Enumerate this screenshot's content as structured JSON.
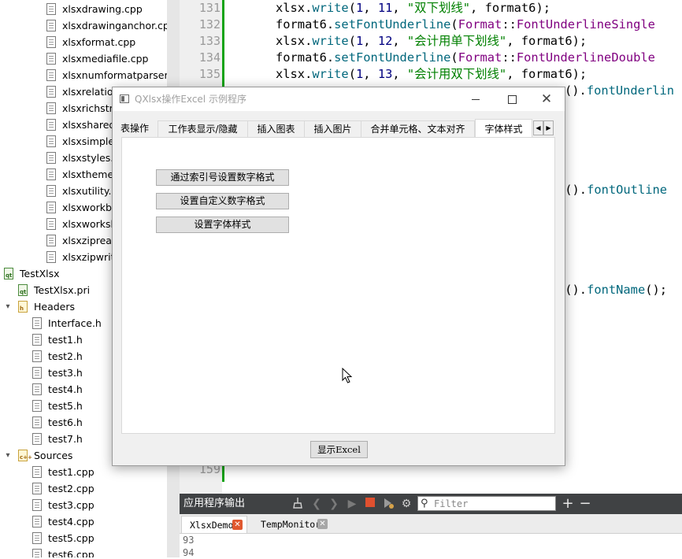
{
  "project_tree": {
    "items": [
      {
        "label": "xlsxdrawing.cpp",
        "icon": "file-icon",
        "indent": 3,
        "arrow": ""
      },
      {
        "label": "xlsxdrawinganchor.cpp",
        "icon": "file-icon",
        "indent": 3,
        "arrow": ""
      },
      {
        "label": "xlsxformat.cpp",
        "icon": "file-icon",
        "indent": 3,
        "arrow": ""
      },
      {
        "label": "xlsxmediafile.cpp",
        "icon": "file-icon",
        "indent": 3,
        "arrow": ""
      },
      {
        "label": "xlsxnumformatparser.c",
        "icon": "file-icon",
        "indent": 3,
        "arrow": ""
      },
      {
        "label": "xlsxrelation",
        "icon": "file-icon",
        "indent": 3,
        "arrow": ""
      },
      {
        "label": "xlsxrichstri",
        "icon": "file-icon",
        "indent": 3,
        "arrow": ""
      },
      {
        "label": "xlsxsharedst",
        "icon": "file-icon",
        "indent": 3,
        "arrow": ""
      },
      {
        "label": "xlsxsimplecc",
        "icon": "file-icon",
        "indent": 3,
        "arrow": ""
      },
      {
        "label": "xlsxstyles.cp",
        "icon": "file-icon",
        "indent": 3,
        "arrow": ""
      },
      {
        "label": "xlsxtheme.cp",
        "icon": "file-icon",
        "indent": 3,
        "arrow": ""
      },
      {
        "label": "xlsxutility.cp",
        "icon": "file-icon",
        "indent": 3,
        "arrow": ""
      },
      {
        "label": "xlsxworkbo",
        "icon": "file-icon",
        "indent": 3,
        "arrow": ""
      },
      {
        "label": "xlsxworksh",
        "icon": "file-icon",
        "indent": 3,
        "arrow": ""
      },
      {
        "label": "xlsxzipread",
        "icon": "file-icon",
        "indent": 3,
        "arrow": ""
      },
      {
        "label": "xlsxzipwrite",
        "icon": "file-icon",
        "indent": 3,
        "arrow": ""
      },
      {
        "label": "TestXlsx",
        "icon": "project-icon",
        "indent": 0,
        "arrow": ""
      },
      {
        "label": "TestXlsx.pri",
        "icon": "pri-file-icon",
        "indent": 1,
        "arrow": ""
      },
      {
        "label": "Headers",
        "icon": "headers-folder-icon",
        "indent": 1,
        "arrow": "▾"
      },
      {
        "label": "Interface.h",
        "icon": "file-icon",
        "indent": 2,
        "arrow": ""
      },
      {
        "label": "test1.h",
        "icon": "file-icon",
        "indent": 2,
        "arrow": ""
      },
      {
        "label": "test2.h",
        "icon": "file-icon",
        "indent": 2,
        "arrow": ""
      },
      {
        "label": "test3.h",
        "icon": "file-icon",
        "indent": 2,
        "arrow": ""
      },
      {
        "label": "test4.h",
        "icon": "file-icon",
        "indent": 2,
        "arrow": ""
      },
      {
        "label": "test5.h",
        "icon": "file-icon",
        "indent": 2,
        "arrow": ""
      },
      {
        "label": "test6.h",
        "icon": "file-icon",
        "indent": 2,
        "arrow": ""
      },
      {
        "label": "test7.h",
        "icon": "file-icon",
        "indent": 2,
        "arrow": ""
      },
      {
        "label": "Sources",
        "icon": "sources-folder-icon",
        "indent": 1,
        "arrow": "▾"
      },
      {
        "label": "test1.cpp",
        "icon": "file-icon",
        "indent": 2,
        "arrow": ""
      },
      {
        "label": "test2.cpp",
        "icon": "file-icon",
        "indent": 2,
        "arrow": ""
      },
      {
        "label": "test3.cpp",
        "icon": "file-icon",
        "indent": 2,
        "arrow": ""
      },
      {
        "label": "test4.cpp",
        "icon": "file-icon",
        "indent": 2,
        "arrow": ""
      },
      {
        "label": "test5.cpp",
        "icon": "file-icon",
        "indent": 2,
        "arrow": ""
      },
      {
        "label": "test6.cpp",
        "icon": "file-icon",
        "indent": 2,
        "arrow": ""
      }
    ]
  },
  "editor": {
    "line_numbers": {
      "l131": "131",
      "l132": "132",
      "l133": "133",
      "l134": "134",
      "l135": "135",
      "l159": "159"
    },
    "code": {
      "l131": [
        {
          "t": "xlsx",
          "c": "obj"
        },
        {
          "t": ".",
          "c": "obj"
        },
        {
          "t": "write",
          "c": "fn"
        },
        {
          "t": "(",
          "c": "obj"
        },
        {
          "t": "1",
          "c": "num"
        },
        {
          "t": ", ",
          "c": "obj"
        },
        {
          "t": "11",
          "c": "num"
        },
        {
          "t": ", ",
          "c": "obj"
        },
        {
          "t": "\"双下划线\"",
          "c": "str"
        },
        {
          "t": ", ",
          "c": "obj"
        },
        {
          "t": "format6",
          "c": "obj"
        },
        {
          "t": ");",
          "c": "obj"
        }
      ],
      "l132": [
        {
          "t": "format6",
          "c": "obj"
        },
        {
          "t": ".",
          "c": "obj"
        },
        {
          "t": "setFontUnderline",
          "c": "fn"
        },
        {
          "t": "(",
          "c": "obj"
        },
        {
          "t": "Format",
          "c": "cls"
        },
        {
          "t": "::",
          "c": "obj"
        },
        {
          "t": "FontUnderlineSingle",
          "c": "enum"
        }
      ],
      "l133": [
        {
          "t": "xlsx",
          "c": "obj"
        },
        {
          "t": ".",
          "c": "obj"
        },
        {
          "t": "write",
          "c": "fn"
        },
        {
          "t": "(",
          "c": "obj"
        },
        {
          "t": "1",
          "c": "num"
        },
        {
          "t": ", ",
          "c": "obj"
        },
        {
          "t": "12",
          "c": "num"
        },
        {
          "t": ", ",
          "c": "obj"
        },
        {
          "t": "\"会计用单下划线\"",
          "c": "str"
        },
        {
          "t": ", ",
          "c": "obj"
        },
        {
          "t": "format6",
          "c": "obj"
        },
        {
          "t": ");",
          "c": "obj"
        }
      ],
      "l134": [
        {
          "t": "format6",
          "c": "obj"
        },
        {
          "t": ".",
          "c": "obj"
        },
        {
          "t": "setFontUnderline",
          "c": "fn"
        },
        {
          "t": "(",
          "c": "obj"
        },
        {
          "t": "Format",
          "c": "cls"
        },
        {
          "t": "::",
          "c": "obj"
        },
        {
          "t": "FontUnderlineDouble",
          "c": "enum"
        }
      ],
      "l135": [
        {
          "t": "xlsx",
          "c": "obj"
        },
        {
          "t": ".",
          "c": "obj"
        },
        {
          "t": "write",
          "c": "fn"
        },
        {
          "t": "(",
          "c": "obj"
        },
        {
          "t": "1",
          "c": "num"
        },
        {
          "t": ", ",
          "c": "obj"
        },
        {
          "t": "13",
          "c": "num"
        },
        {
          "t": ", ",
          "c": "obj"
        },
        {
          "t": "\"会计用双下划线\"",
          "c": "str"
        },
        {
          "t": ", ",
          "c": "obj"
        },
        {
          "t": "format6",
          "c": "obj"
        },
        {
          "t": ");",
          "c": "obj"
        }
      ],
      "frag1": [
        {
          "t": "().",
          "c": "obj"
        },
        {
          "t": "fontUnderlin",
          "c": "fn"
        }
      ],
      "frag2": [
        {
          "t": ";",
          "c": "obj"
        }
      ],
      "frag3": [
        {
          "t": "t().",
          "c": "obj"
        },
        {
          "t": "fontOutline",
          "c": "fn"
        }
      ],
      "frag4": [
        {
          "t": ";",
          "c": "obj"
        }
      ],
      "frag5": [
        {
          "t": "t().",
          "c": "obj"
        },
        {
          "t": "fontName",
          "c": "fn"
        },
        {
          "t": "();",
          "c": "obj"
        }
      ]
    }
  },
  "output_panel": {
    "title": "应用程序输出",
    "filter_placeholder": "Filter",
    "tabs": [
      {
        "label": "XlsxDemo",
        "active": true
      },
      {
        "label": "TempMonitor",
        "active": false
      }
    ],
    "lines": [
      "93",
      "94"
    ]
  },
  "dialog": {
    "title": "QXlsx操作Excel 示例程序",
    "tabs": [
      {
        "label": "表操作",
        "selected": false
      },
      {
        "label": "工作表显示/隐藏",
        "selected": false
      },
      {
        "label": "插入图表",
        "selected": false
      },
      {
        "label": "插入图片",
        "selected": false
      },
      {
        "label": "合并单元格、文本对齐",
        "selected": false
      },
      {
        "label": "字体样式",
        "selected": true
      }
    ],
    "buttons": {
      "index_number_format": "通过索引号设置数字格式",
      "custom_number_format": "设置自定义数字格式",
      "font_style": "设置字体样式"
    },
    "show_excel": "显示Excel"
  },
  "colors": {
    "accent_close": "#e0582f",
    "change_bar": "#12a312",
    "string": "#008000",
    "function": "#00677c",
    "enum": "#800080",
    "number": "#000080"
  }
}
